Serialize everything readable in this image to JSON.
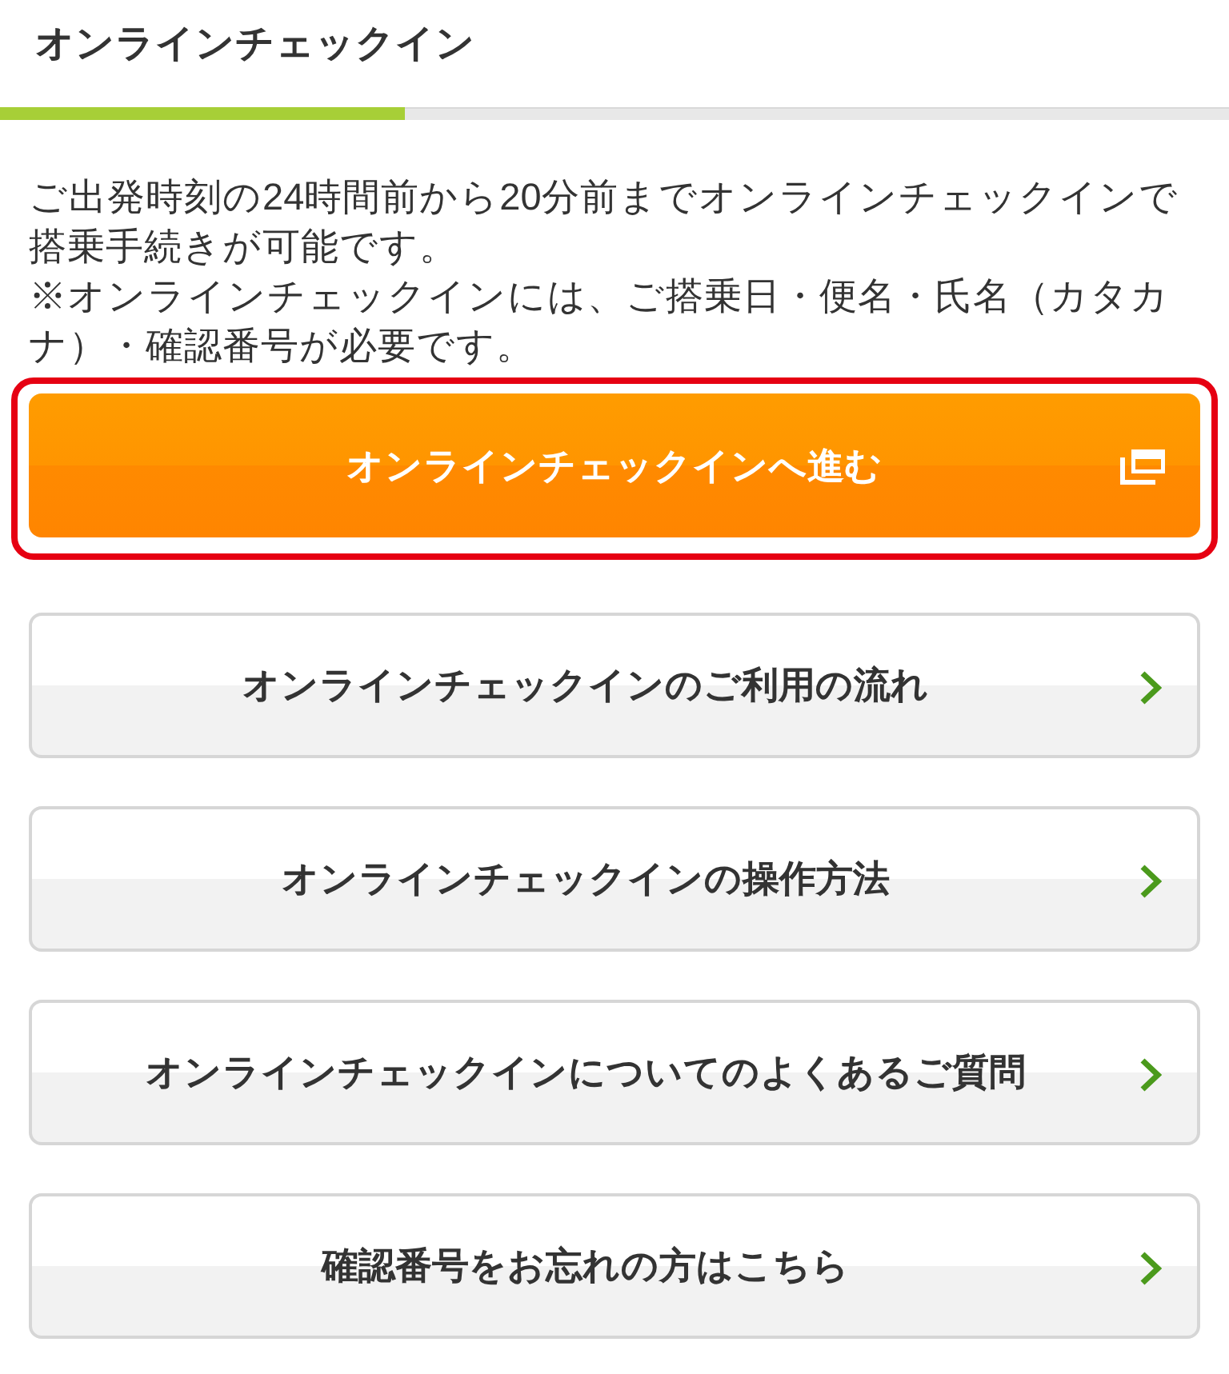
{
  "header": {
    "title": "オンラインチェックイン"
  },
  "progress": {
    "level": 0.33
  },
  "notes": [
    "ご出発時刻の24時間前から20分前までオンラインチェックインで搭乗手続きが可能です。",
    "※オンラインチェックインには、ご搭乗日・便名・氏名（カタカナ）・確認番号が必要です。"
  ],
  "primary_button": {
    "label": "オンラインチェックインへ進む",
    "highlighted": true
  },
  "links": [
    {
      "label": "オンラインチェックインのご利用の流れ"
    },
    {
      "label": "オンラインチェックインの操作方法"
    },
    {
      "label": "オンラインチェックインについてのよくあるご質問"
    },
    {
      "label": "確認番号をお忘れの方はこちら"
    }
  ]
}
